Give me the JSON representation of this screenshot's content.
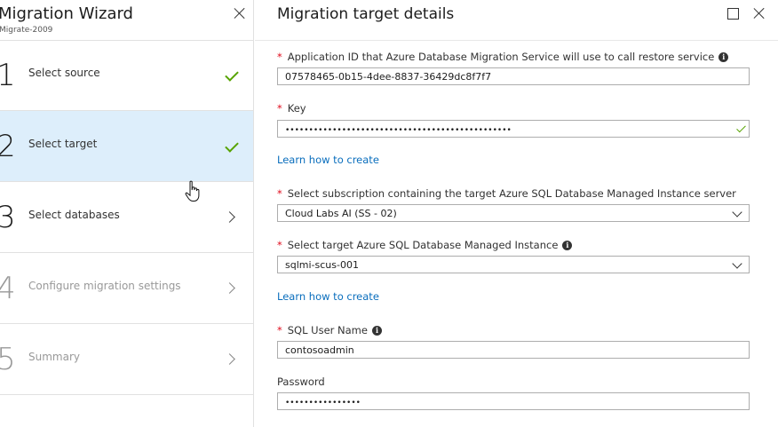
{
  "wizard": {
    "title": "Migration Wizard",
    "subtitle": "Migrate-2009",
    "steps": [
      {
        "number": "1",
        "label": "Select source",
        "status": "complete",
        "icon": "checkmark-icon"
      },
      {
        "number": "2",
        "label": "Select target",
        "status": "complete",
        "icon": "checkmark-icon",
        "selected": true
      },
      {
        "number": "3",
        "label": "Select databases",
        "status": "available",
        "icon": "chevron-right-icon"
      },
      {
        "number": "4",
        "label": "Configure migration settings",
        "status": "disabled",
        "icon": "chevron-right-icon"
      },
      {
        "number": "5",
        "label": "Summary",
        "status": "disabled",
        "icon": "chevron-right-icon"
      }
    ]
  },
  "blade": {
    "title": "Migration target details",
    "fields": {
      "app_id": {
        "required_mark": "*",
        "label": "Application ID that Azure Database Migration Service will use to call restore service",
        "value": "07578465-0b15-4dee-8837-36429dc8f7f7"
      },
      "key": {
        "required_mark": "*",
        "label": "Key",
        "value": "••••••••••••••••••••••••••••••••••••••••••••••••",
        "validated": true
      },
      "learn_link_1": "Learn how to create",
      "subscription": {
        "required_mark": "*",
        "label": "Select subscription containing the target Azure SQL Database Managed Instance server",
        "value": "Cloud Labs AI (SS - 02)"
      },
      "managed_instance": {
        "required_mark": "*",
        "label": "Select target Azure SQL Database Managed Instance",
        "value": "sqlmi-scus-001"
      },
      "learn_link_2": "Learn how to create",
      "sql_user": {
        "required_mark": "*",
        "label": "SQL User Name",
        "value": "contosoadmin"
      },
      "password": {
        "label": "Password",
        "value": "••••••••••••••••"
      }
    }
  },
  "colors": {
    "selected_step_bg": "#ddeefb",
    "success_green": "#57a300",
    "required_red": "#e00b1c",
    "link_blue": "#0a6ebd"
  }
}
